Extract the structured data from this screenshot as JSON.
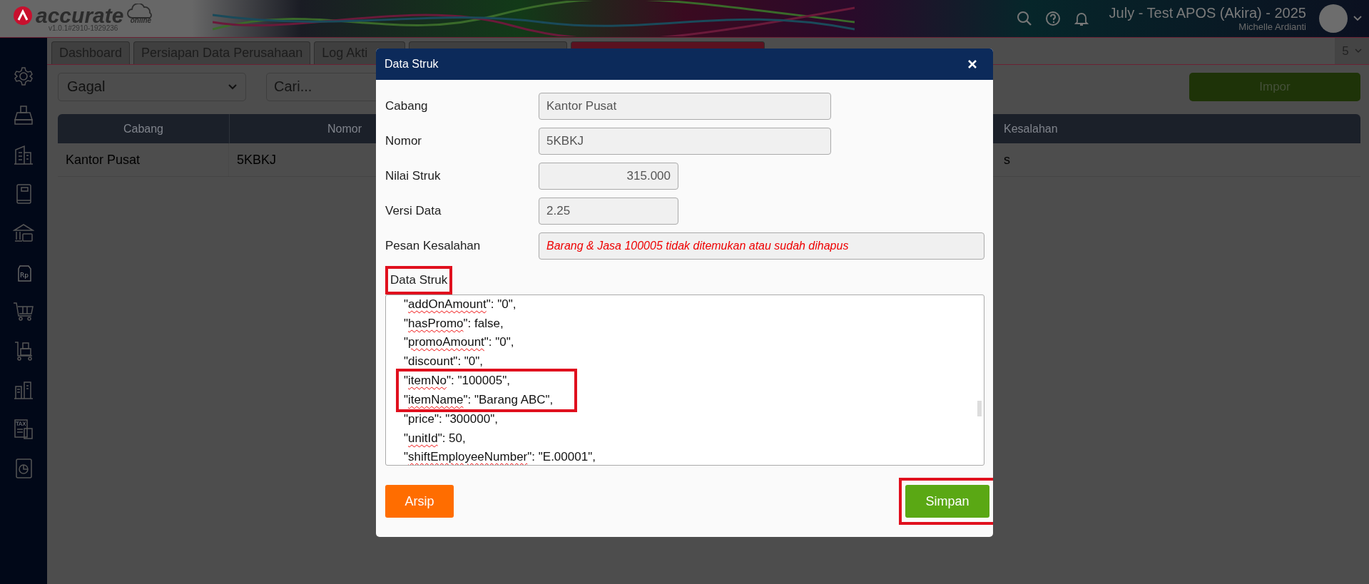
{
  "header": {
    "logo_text": "accurate",
    "logo_sub": "online",
    "version": "v1.0.1#2910-1929236",
    "company": "July - Test APOS (Akira) - 2025",
    "user": "Michelle Ardianti"
  },
  "sidebar": {
    "items": [
      {
        "kind": "settings"
      },
      {
        "kind": "fax"
      },
      {
        "kind": "building"
      },
      {
        "kind": "book"
      },
      {
        "kind": "bank"
      },
      {
        "kind": "tag",
        "icon_text": "Rp"
      },
      {
        "kind": "cart"
      },
      {
        "kind": "trolley"
      },
      {
        "kind": "factory"
      },
      {
        "kind": "tax",
        "icon_text": "TAX"
      },
      {
        "kind": "report"
      }
    ]
  },
  "tabs": [
    {
      "label": "Dashboard",
      "kind": "normal"
    },
    {
      "label": "Persiapan Data Perusahaan",
      "kind": "normal"
    },
    {
      "label": "Log Akti",
      "kind": "closable"
    },
    {
      "kind": "covered"
    },
    {
      "kind": "alert"
    }
  ],
  "tab_count": "5",
  "toolbar": {
    "filter": "Gagal",
    "search_placeholder": "Cari...",
    "import_button": "Impor"
  },
  "table": {
    "columns": [
      "Cabang",
      "Nomor",
      "Kesalahan"
    ],
    "rows": [
      [
        "Kantor Pusat",
        "5KBKJ",
        "s"
      ]
    ]
  },
  "dialog": {
    "title": "Data Struk",
    "fields": [
      {
        "label": "Cabang",
        "value": "Kantor Pusat",
        "kind": "text"
      },
      {
        "label": "Nomor",
        "value": "5KBKJ",
        "kind": "text"
      },
      {
        "label": "Nilai Struk",
        "value": "315.000",
        "kind": "number"
      },
      {
        "label": "Versi Data",
        "value": "2.25",
        "kind": "short"
      },
      {
        "label": "Pesan Kesalahan",
        "value": "Barang & Jasa 100005 tidak ditemukan atau sudah dihapus",
        "kind": "error"
      }
    ],
    "data_label": "Data Struk",
    "data_label_highlighted": true,
    "code_lines": [
      {
        "pre": "\"",
        "word": "addOnAmount",
        "post": "\": \"0\",",
        "highlighted": false
      },
      {
        "pre": "\"",
        "word": "hasPromo",
        "post": "\": false,",
        "highlighted": false
      },
      {
        "pre": "\"",
        "word": "promoAmount",
        "post": "\": \"0\",",
        "highlighted": false
      },
      {
        "pre": "\"discount\": \"0\",",
        "highlighted": false
      },
      {
        "pre": "\"",
        "word": "itemNo",
        "post": "\": \"100005\",",
        "highlighted": true
      },
      {
        "pre": "\"",
        "word": "itemName",
        "post": "\": \"Barang ABC\",",
        "highlighted": true
      },
      {
        "pre": "\"price\": \"300000\",",
        "highlighted": false
      },
      {
        "pre": "\"",
        "word": "unitId",
        "post": "\": 50,",
        "highlighted": false
      },
      {
        "pre": "\"",
        "word": "shiftEmployeeNumber",
        "post": "\": \"E.00001\",",
        "highlighted": false
      }
    ],
    "archive_button": "Arsip",
    "save_button": "Simpan",
    "save_highlighted": true
  }
}
